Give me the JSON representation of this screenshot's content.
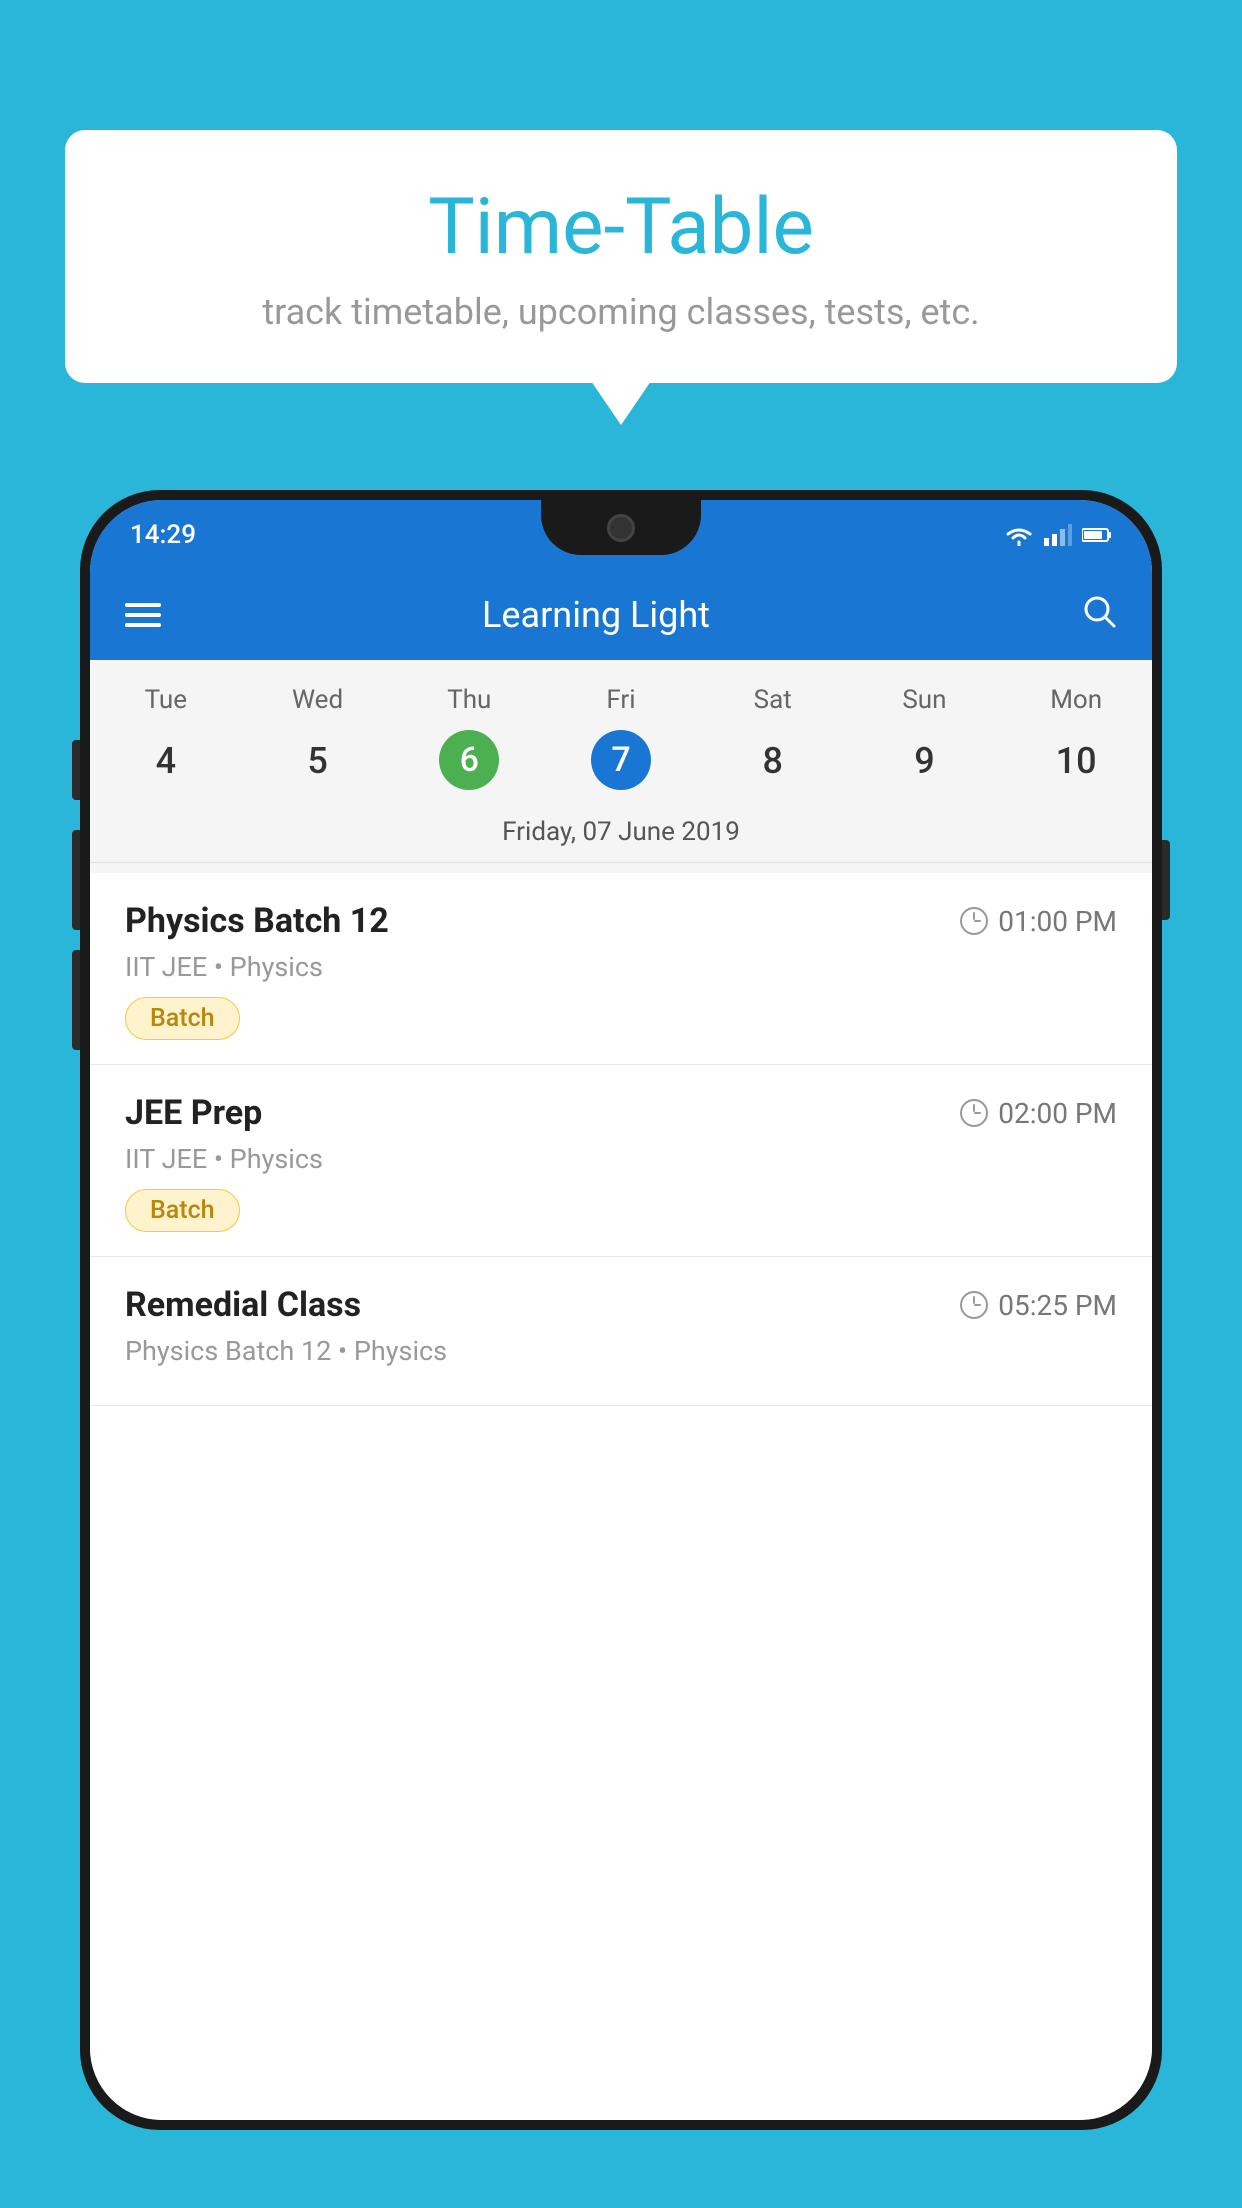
{
  "background_color": "#29B6D8",
  "speech_bubble": {
    "title": "Time-Table",
    "subtitle": "track timetable, upcoming classes, tests, etc."
  },
  "phone": {
    "status_bar": {
      "time": "14:29",
      "icons": [
        "wifi",
        "signal",
        "battery"
      ]
    },
    "toolbar": {
      "menu_icon": "hamburger",
      "title": "Learning Light",
      "search_icon": "search"
    },
    "calendar": {
      "day_headers": [
        "Tue",
        "Wed",
        "Thu",
        "Fri",
        "Sat",
        "Sun",
        "Mon"
      ],
      "day_numbers": [
        "4",
        "5",
        "6",
        "7",
        "8",
        "9",
        "10"
      ],
      "today_index": 2,
      "selected_index": 3,
      "selected_date_label": "Friday, 07 June 2019"
    },
    "schedule": [
      {
        "title": "Physics Batch 12",
        "time": "01:00 PM",
        "subtitle": "IIT JEE • Physics",
        "badge": "Batch"
      },
      {
        "title": "JEE Prep",
        "time": "02:00 PM",
        "subtitle": "IIT JEE • Physics",
        "badge": "Batch"
      },
      {
        "title": "Remedial Class",
        "time": "05:25 PM",
        "subtitle": "Physics Batch 12 • Physics",
        "badge": null
      }
    ]
  }
}
